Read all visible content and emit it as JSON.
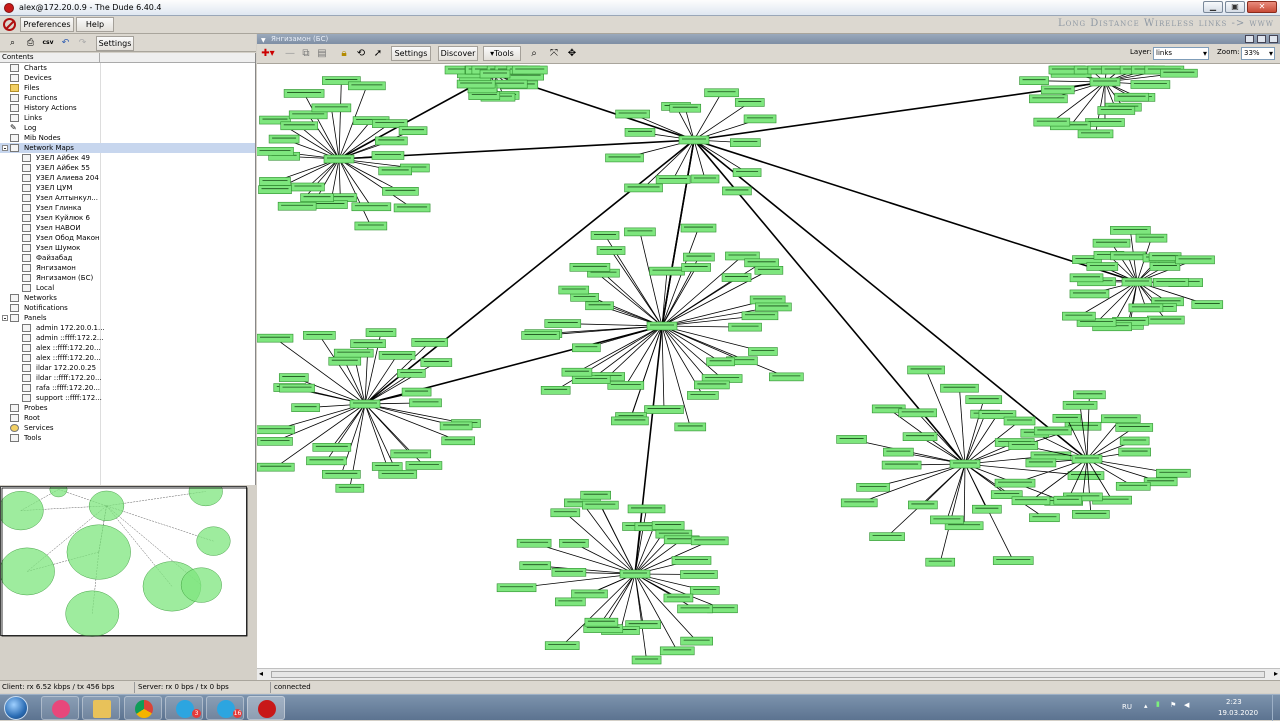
{
  "window": {
    "title": "alex@172.20.0.9 - The Dude 6.40.4",
    "banner": "Long Distance Wireless links -> www"
  },
  "menu": {
    "preferences": "Preferences",
    "help": "Help"
  },
  "left_toolbar": {
    "csv": "csv",
    "settings": "Settings"
  },
  "tree": {
    "header": "Contents",
    "items": [
      {
        "label": "Charts",
        "indent": 0
      },
      {
        "label": "Devices",
        "indent": 0
      },
      {
        "label": "Files",
        "indent": 0,
        "icon": "folder-icon"
      },
      {
        "label": "Functions",
        "indent": 0
      },
      {
        "label": "History Actions",
        "indent": 0
      },
      {
        "label": "Links",
        "indent": 0
      },
      {
        "label": "Log",
        "indent": 0,
        "icon": "pen-icon"
      },
      {
        "label": "Mib Nodes",
        "indent": 0
      },
      {
        "label": "Network Maps",
        "indent": 0,
        "expanded": true,
        "selected": true
      },
      {
        "label": "УЗЕЛ Айбек 49",
        "indent": 1
      },
      {
        "label": "УЗЕЛ Айбек 55",
        "indent": 1
      },
      {
        "label": "УЗЕЛ Алиева 204",
        "indent": 1
      },
      {
        "label": "УЗЕЛ ЦУМ",
        "indent": 1
      },
      {
        "label": "Узел Алтынкул...",
        "indent": 1
      },
      {
        "label": "Узел Глинка",
        "indent": 1
      },
      {
        "label": "Узел Куйлюк 6",
        "indent": 1
      },
      {
        "label": "Узел НАВОИ",
        "indent": 1
      },
      {
        "label": "Узел Обод Макон",
        "indent": 1
      },
      {
        "label": "Узел Шумок",
        "indent": 1
      },
      {
        "label": "Файзабад",
        "indent": 1
      },
      {
        "label": "Янгизамон",
        "indent": 1
      },
      {
        "label": "Янгизамон (БС)",
        "indent": 1
      },
      {
        "label": "Local",
        "indent": 1
      },
      {
        "label": "Networks",
        "indent": 0
      },
      {
        "label": "Notifications",
        "indent": 0
      },
      {
        "label": "Panels",
        "indent": 0,
        "expanded": true
      },
      {
        "label": "admin 172.20.0.1...",
        "indent": 1
      },
      {
        "label": "admin ::ffff:172.2...",
        "indent": 1
      },
      {
        "label": "alex ::ffff:172.20...",
        "indent": 1
      },
      {
        "label": "alex ::ffff:172.20...",
        "indent": 1
      },
      {
        "label": "ildar 172.20.0.25",
        "indent": 1
      },
      {
        "label": "ildar ::ffff:172.20...",
        "indent": 1
      },
      {
        "label": "rafa ::ffff:172.20...",
        "indent": 1
      },
      {
        "label": "support ::ffff:172...",
        "indent": 1
      },
      {
        "label": "Probes",
        "indent": 0
      },
      {
        "label": "Root",
        "indent": 0
      },
      {
        "label": "Services",
        "indent": 0,
        "icon": "services-icon"
      },
      {
        "label": "Tools",
        "indent": 0
      }
    ]
  },
  "map": {
    "tab_title": "Янгизамон (БС)",
    "toolbar": {
      "settings": "Settings",
      "discover": "Discover",
      "tools": "▾Tools",
      "layer_label": "Layer:",
      "layer_value": "links",
      "zoom_label": "Zoom:",
      "zoom_value": "33%"
    },
    "clusters": [
      {
        "id": "c1",
        "n": 28
      },
      {
        "id": "c2",
        "n": 14
      },
      {
        "id": "c3",
        "n": 22
      },
      {
        "id": "c4",
        "n": 26
      },
      {
        "id": "c5",
        "n": 30
      },
      {
        "id": "c6",
        "n": 40
      },
      {
        "id": "c7",
        "n": 32
      },
      {
        "id": "c8",
        "n": 28
      },
      {
        "id": "c9",
        "n": 20
      },
      {
        "id": "c10",
        "n": 18
      }
    ]
  },
  "colors": {
    "node_fill": "#7ee67e",
    "node_border": "#2f8f2f",
    "selection": "#c7d6ee",
    "link": "#000000"
  },
  "status": {
    "client": "Client: rx 6.52 kbps / tx 456 bps",
    "server": "Server: rx 0 bps / tx 0 bps",
    "connection": "connected"
  },
  "taskbar": {
    "apps": [
      "start-orb",
      "browser-rossa",
      "explorer",
      "chrome",
      "telegram",
      "telegram",
      "dude"
    ],
    "lang": "RU",
    "time": "2:23",
    "date": "19.03.2020",
    "badge1": "3",
    "badge2": "16"
  }
}
